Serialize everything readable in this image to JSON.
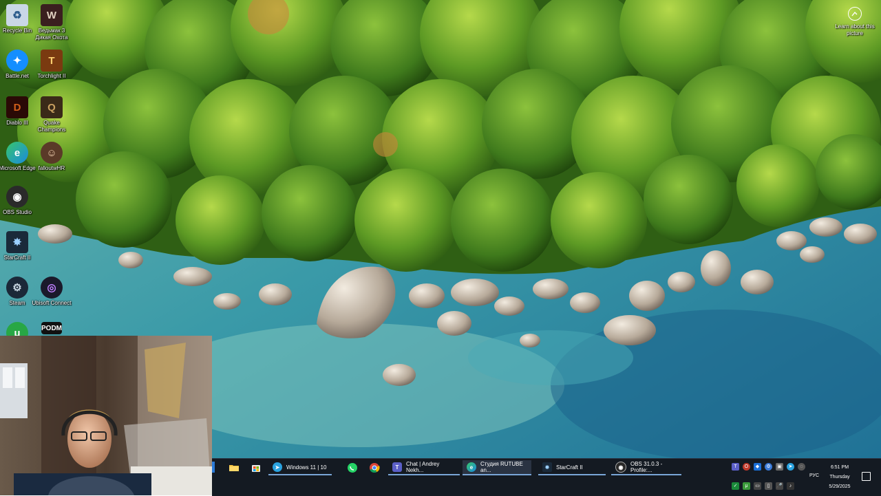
{
  "desktop": {
    "icons": [
      {
        "label": "Recycle Bin",
        "icon": "recycle-bin-icon"
      },
      {
        "label": "Ведьмак 3 Дикая Охота",
        "icon": "witcher-icon"
      },
      {
        "label": "Battle.net",
        "icon": "battlenet-icon"
      },
      {
        "label": "Torchlight II",
        "icon": "torchlight-icon"
      },
      {
        "label": "Diablo III",
        "icon": "diablo-icon"
      },
      {
        "label": "Quake Champions",
        "icon": "quake-icon"
      },
      {
        "label": "Microsoft Edge",
        "icon": "edge-icon"
      },
      {
        "label": "falloutwHR",
        "icon": "fallout-icon"
      },
      {
        "label": "OBS Studio",
        "icon": "obs-icon"
      },
      {
        "label": "StarCraft II",
        "icon": "starcraft-icon"
      },
      {
        "label": "Steam",
        "icon": "steam-icon"
      },
      {
        "label": "Ubisoft Connect",
        "icon": "ubisoft-icon"
      },
      {
        "label": "",
        "icon": "utorrent-icon"
      },
      {
        "label": "",
        "icon": "podm-icon"
      }
    ],
    "podm_text": "PODM",
    "learn_label": "Learn about this picture"
  },
  "taskbar": {
    "items": [
      {
        "label": "Windows 11 | 10",
        "icon": "telegram-icon"
      },
      {
        "label": "Chat | Andrey Nekh...",
        "icon": "teams-chat-icon"
      },
      {
        "label": "Студия RUTUBE an...",
        "icon": "edge-icon"
      },
      {
        "label": "StarCraft II",
        "icon": "starcraft-icon"
      },
      {
        "label": "OBS 31.0.3 - Profile:...",
        "icon": "obs-icon"
      }
    ],
    "pinned": [
      "file-explorer-icon",
      "store-icon",
      "whatsapp-icon",
      "chrome-icon"
    ],
    "tray": {
      "language": "РУС",
      "time": "6:51 PM",
      "day": "Thursday",
      "date": "5/29/2025"
    }
  },
  "colors": {
    "taskbar_bg": "#141a22",
    "accent": "#7aa6d8",
    "water": "#3a8fa8",
    "forest": "#3e7a1e"
  }
}
